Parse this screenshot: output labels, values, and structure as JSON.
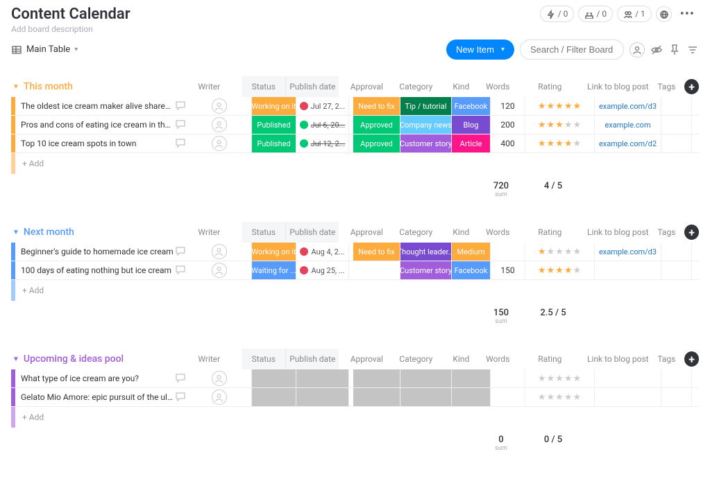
{
  "title": "Content Calendar",
  "description_placeholder": "Add board description",
  "header_badges": {
    "automations": "/ 0",
    "integrations": "/ 0",
    "people": "/ 1"
  },
  "view": {
    "name": "Main Table"
  },
  "toolbar": {
    "new_item": "New Item",
    "search_placeholder": "Search / Filter Board"
  },
  "columns": {
    "writer": "Writer",
    "status": "Status",
    "publish_date": "Publish date",
    "approval": "Approval",
    "category": "Category",
    "kind": "Kind",
    "words": "Words",
    "rating": "Rating",
    "link": "Link to blog post",
    "tags": "Tags"
  },
  "add_label": "+ Add",
  "status_colors": {
    "working_on_it": {
      "label": "Working on it",
      "bg": "#fdab3d"
    },
    "published": {
      "label": "Published",
      "bg": "#00c875"
    },
    "waiting_for": {
      "label": "Waiting for ...",
      "bg": "#579bfc"
    }
  },
  "approval_colors": {
    "need_to_fix": {
      "label": "Need to fix",
      "bg": "#fdab3d"
    },
    "approved": {
      "label": "Approved",
      "bg": "#00c875"
    }
  },
  "category_colors": {
    "tip_tutorial": {
      "label": "Tip / tutorial",
      "bg": "#037f4c"
    },
    "company_news": {
      "label": "Company news",
      "bg": "#66ccff"
    },
    "customer_story": {
      "label": "Customer story",
      "bg": "#a25ddc"
    },
    "thought_leader": {
      "label": "Thought leader...",
      "bg": "#784bd1"
    }
  },
  "kind_colors": {
    "facebook": {
      "label": "Facebook",
      "bg": "#579bfc"
    },
    "blog": {
      "label": "Blog",
      "bg": "#784bd1"
    },
    "article": {
      "label": "Article",
      "bg": "#ff158a"
    },
    "medium": {
      "label": "Medium",
      "bg": "#fdab3d"
    }
  },
  "groups": [
    {
      "name": "This month",
      "color": "#fdab3d",
      "rows": [
        {
          "name": "The oldest ice cream maker alive shares his se...",
          "status": "working_on_it",
          "date": "Jul 27, 2...",
          "date_dot": "#e2445c",
          "date_strike": false,
          "approval": "need_to_fix",
          "category": "tip_tutorial",
          "kind": "facebook",
          "words": "120",
          "rating": 5,
          "link": "example.com/d3"
        },
        {
          "name": "Pros and cons of eating ice cream in the winter",
          "status": "published",
          "date": "Jul 6, 20...",
          "date_dot": "#00c875",
          "date_strike": true,
          "approval": "approved",
          "category": "company_news",
          "kind": "blog",
          "words": "200",
          "rating": 3,
          "link": "example.com"
        },
        {
          "name": "Top 10 ice cream spots in town",
          "status": "published",
          "date": "Jul 12, 2...",
          "date_dot": "#00c875",
          "date_strike": true,
          "approval": "approved",
          "category": "customer_story",
          "kind": "article",
          "words": "400",
          "rating": 4,
          "link": "example.com/d2"
        }
      ],
      "summary": {
        "words": "720",
        "words_lbl": "sum",
        "rating": "4 / 5"
      }
    },
    {
      "name": "Next month",
      "color": "#579bfc",
      "rows": [
        {
          "name": "Beginner's guide to homemade ice cream",
          "status": "working_on_it",
          "date": "Aug 4, 2...",
          "date_dot": "#e2445c",
          "date_strike": false,
          "approval": "need_to_fix",
          "category": "thought_leader",
          "kind": "medium",
          "words": "",
          "rating": 1,
          "link": "example.com/d3"
        },
        {
          "name": "100 days of eating nothing but ice cream",
          "status": "waiting_for",
          "date": "Aug 25, ...",
          "date_dot": "#e2445c",
          "date_strike": false,
          "approval": "",
          "category": "customer_story",
          "kind": "facebook",
          "words": "150",
          "rating": 4,
          "link": ""
        }
      ],
      "summary": {
        "words": "150",
        "words_lbl": "sum",
        "rating": "2.5 / 5"
      }
    },
    {
      "name": "Upcoming & ideas pool",
      "color": "#a25ddc",
      "rows": [
        {
          "name": "What type of ice cream are you?",
          "status": "",
          "date": "",
          "date_dot": "",
          "date_strike": false,
          "approval": "",
          "category": "",
          "kind": "",
          "words": "",
          "rating": 0,
          "link": ""
        },
        {
          "name": "Gelato Mio Amore: epic pursuit of the ultimate i...",
          "status": "",
          "date": "",
          "date_dot": "",
          "date_strike": false,
          "approval": "",
          "category": "",
          "kind": "",
          "words": "",
          "rating": 0,
          "link": ""
        }
      ],
      "summary": {
        "words": "0",
        "words_lbl": "sum",
        "rating": "0 / 5"
      }
    }
  ]
}
